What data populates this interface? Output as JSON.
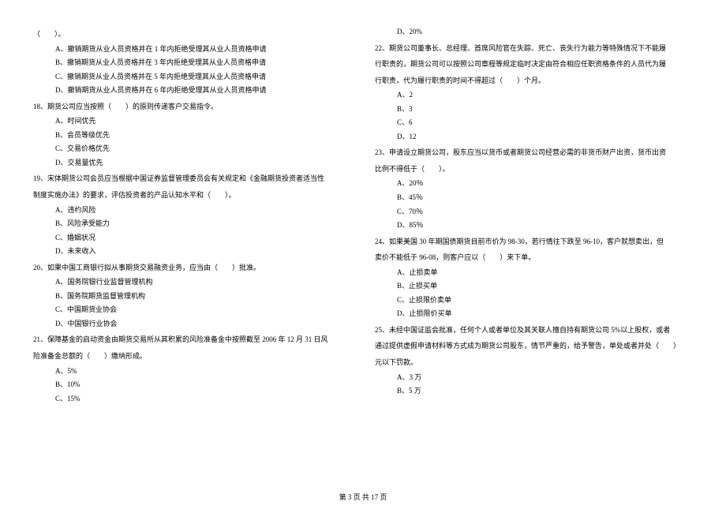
{
  "left_column": {
    "q17_stem": "（　　）。",
    "q17_options": [
      "A、撤销期货从业人员资格并在 1 年内拒绝受理其从业人员资格申请",
      "B、撤销期货从业人员资格并在 3 年内拒绝受理其从业人员资格申请",
      "C、撤销期货从业人员资格并在 5 年内拒绝受理其从业人员资格申请",
      "D、撤销期货从业人员资格并在 6 年内拒绝受理其从业人员资格申请"
    ],
    "q18_stem": "18、期货公司应当按照（　　）的原则传递客户交易指令。",
    "q18_options": [
      "A、时间优先",
      "B、会员等级优先",
      "C、交易价格优先",
      "D、交易量优先"
    ],
    "q19_stem_a": "19、宋体期货公司会员应当根据中国证券监督管理委员会有关规定和《金融期货投资者适当性",
    "q19_stem_b": "制度实施办法》的要求，评估投资者的产品认知水平和（　　）。",
    "q19_options": [
      "A、违约风险",
      "B、风险承受能力",
      "C、婚姻状况",
      "D、未来收入"
    ],
    "q20_stem": "20、如果中国工商银行拟从事期货交易融资业务，应当由（　　）批准。",
    "q20_options": [
      "A、国务院银行业监督管理机构",
      "B、国务院期货监督管理机构",
      "C、中国期货业协会",
      "D、中国银行业协会"
    ],
    "q21_stem_a": "21、保障基金的启动资金由期货交易所从其积累的风险准备金中按照截至 2006 年 12 月 31 日风",
    "q21_stem_b": "险准备金总额的（　　）缴纳形成。",
    "q21_options": [
      "A、5%",
      "B、10%",
      "C、15%"
    ]
  },
  "right_column": {
    "q21_option_d": "D、20%",
    "q22_stem_a": "22、期货公司董事长、总经理、首席风险官在失踪、死亡、丧失行为能力等特殊情况下不能履",
    "q22_stem_b": "行职责的，期货公司可以按照公司章程等规定临时决定由符合相应任职资格条件的人员代为履",
    "q22_stem_c": "行职责，代为履行职责的时间不得超过（　　）个月。",
    "q22_options": [
      "A、2",
      "B、3",
      "C、6",
      "D、12"
    ],
    "q23_stem_a": "23、申请设立期货公司，股东应当以货币或者期货公司经营必需的非货币财产出资，货币出资",
    "q23_stem_b": "比例不得低于（　　）。",
    "q23_options": [
      "A、20％",
      "B、45％",
      "C、70％",
      "D、85％"
    ],
    "q24_stem_a": "24、如果美国 30 年期国债期货目前市价为 98-30，若行情往下跌至 96-10，客户就想卖出，但",
    "q24_stem_b": "卖价不能低于 96-08，则客户应以（　　）来下单。",
    "q24_options": [
      "A、止损卖单",
      "B、止损买单",
      "C、止损限价卖单",
      "D、止损限价买单"
    ],
    "q25_stem_a": "25、未经中国证监会批准，任何个人或者单位及其关联人擅自持有期货公司 5%以上股权，或者",
    "q25_stem_b": "通过提供虚假申请材料等方式成为期货公司股东，情节严重的，给予警告，单处或者并处（　　）",
    "q25_stem_c": "元以下罚款。",
    "q25_options": [
      "A、3 万",
      "B、5 万"
    ]
  },
  "footer": "第 3 页 共 17 页"
}
